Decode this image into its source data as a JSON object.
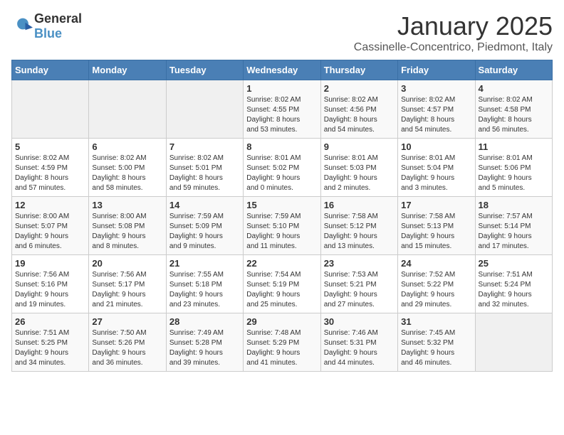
{
  "header": {
    "logo": {
      "general": "General",
      "blue": "Blue"
    },
    "title": "January 2025",
    "location": "Cassinelle-Concentrico, Piedmont, Italy"
  },
  "weekdays": [
    "Sunday",
    "Monday",
    "Tuesday",
    "Wednesday",
    "Thursday",
    "Friday",
    "Saturday"
  ],
  "weeks": [
    [
      {
        "day": "",
        "info": ""
      },
      {
        "day": "",
        "info": ""
      },
      {
        "day": "",
        "info": ""
      },
      {
        "day": "1",
        "info": "Sunrise: 8:02 AM\nSunset: 4:55 PM\nDaylight: 8 hours\nand 53 minutes."
      },
      {
        "day": "2",
        "info": "Sunrise: 8:02 AM\nSunset: 4:56 PM\nDaylight: 8 hours\nand 54 minutes."
      },
      {
        "day": "3",
        "info": "Sunrise: 8:02 AM\nSunset: 4:57 PM\nDaylight: 8 hours\nand 54 minutes."
      },
      {
        "day": "4",
        "info": "Sunrise: 8:02 AM\nSunset: 4:58 PM\nDaylight: 8 hours\nand 56 minutes."
      }
    ],
    [
      {
        "day": "5",
        "info": "Sunrise: 8:02 AM\nSunset: 4:59 PM\nDaylight: 8 hours\nand 57 minutes."
      },
      {
        "day": "6",
        "info": "Sunrise: 8:02 AM\nSunset: 5:00 PM\nDaylight: 8 hours\nand 58 minutes."
      },
      {
        "day": "7",
        "info": "Sunrise: 8:02 AM\nSunset: 5:01 PM\nDaylight: 8 hours\nand 59 minutes."
      },
      {
        "day": "8",
        "info": "Sunrise: 8:01 AM\nSunset: 5:02 PM\nDaylight: 9 hours\nand 0 minutes."
      },
      {
        "day": "9",
        "info": "Sunrise: 8:01 AM\nSunset: 5:03 PM\nDaylight: 9 hours\nand 2 minutes."
      },
      {
        "day": "10",
        "info": "Sunrise: 8:01 AM\nSunset: 5:04 PM\nDaylight: 9 hours\nand 3 minutes."
      },
      {
        "day": "11",
        "info": "Sunrise: 8:01 AM\nSunset: 5:06 PM\nDaylight: 9 hours\nand 5 minutes."
      }
    ],
    [
      {
        "day": "12",
        "info": "Sunrise: 8:00 AM\nSunset: 5:07 PM\nDaylight: 9 hours\nand 6 minutes."
      },
      {
        "day": "13",
        "info": "Sunrise: 8:00 AM\nSunset: 5:08 PM\nDaylight: 9 hours\nand 8 minutes."
      },
      {
        "day": "14",
        "info": "Sunrise: 7:59 AM\nSunset: 5:09 PM\nDaylight: 9 hours\nand 9 minutes."
      },
      {
        "day": "15",
        "info": "Sunrise: 7:59 AM\nSunset: 5:10 PM\nDaylight: 9 hours\nand 11 minutes."
      },
      {
        "day": "16",
        "info": "Sunrise: 7:58 AM\nSunset: 5:12 PM\nDaylight: 9 hours\nand 13 minutes."
      },
      {
        "day": "17",
        "info": "Sunrise: 7:58 AM\nSunset: 5:13 PM\nDaylight: 9 hours\nand 15 minutes."
      },
      {
        "day": "18",
        "info": "Sunrise: 7:57 AM\nSunset: 5:14 PM\nDaylight: 9 hours\nand 17 minutes."
      }
    ],
    [
      {
        "day": "19",
        "info": "Sunrise: 7:56 AM\nSunset: 5:16 PM\nDaylight: 9 hours\nand 19 minutes."
      },
      {
        "day": "20",
        "info": "Sunrise: 7:56 AM\nSunset: 5:17 PM\nDaylight: 9 hours\nand 21 minutes."
      },
      {
        "day": "21",
        "info": "Sunrise: 7:55 AM\nSunset: 5:18 PM\nDaylight: 9 hours\nand 23 minutes."
      },
      {
        "day": "22",
        "info": "Sunrise: 7:54 AM\nSunset: 5:19 PM\nDaylight: 9 hours\nand 25 minutes."
      },
      {
        "day": "23",
        "info": "Sunrise: 7:53 AM\nSunset: 5:21 PM\nDaylight: 9 hours\nand 27 minutes."
      },
      {
        "day": "24",
        "info": "Sunrise: 7:52 AM\nSunset: 5:22 PM\nDaylight: 9 hours\nand 29 minutes."
      },
      {
        "day": "25",
        "info": "Sunrise: 7:51 AM\nSunset: 5:24 PM\nDaylight: 9 hours\nand 32 minutes."
      }
    ],
    [
      {
        "day": "26",
        "info": "Sunrise: 7:51 AM\nSunset: 5:25 PM\nDaylight: 9 hours\nand 34 minutes."
      },
      {
        "day": "27",
        "info": "Sunrise: 7:50 AM\nSunset: 5:26 PM\nDaylight: 9 hours\nand 36 minutes."
      },
      {
        "day": "28",
        "info": "Sunrise: 7:49 AM\nSunset: 5:28 PM\nDaylight: 9 hours\nand 39 minutes."
      },
      {
        "day": "29",
        "info": "Sunrise: 7:48 AM\nSunset: 5:29 PM\nDaylight: 9 hours\nand 41 minutes."
      },
      {
        "day": "30",
        "info": "Sunrise: 7:46 AM\nSunset: 5:31 PM\nDaylight: 9 hours\nand 44 minutes."
      },
      {
        "day": "31",
        "info": "Sunrise: 7:45 AM\nSunset: 5:32 PM\nDaylight: 9 hours\nand 46 minutes."
      },
      {
        "day": "",
        "info": ""
      }
    ]
  ]
}
